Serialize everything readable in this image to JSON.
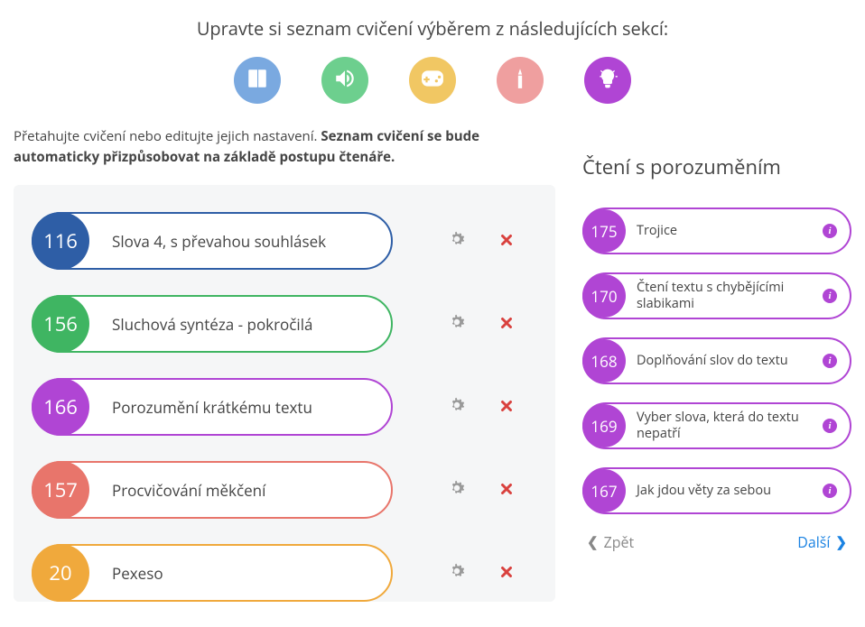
{
  "heading": "Upravte si seznam cvičení výběrem z následujících sekcí:",
  "instructions": {
    "pre": "Přetahujte cvičení nebo editujte jejich nastavení. ",
    "bold": "Seznam cvičení se bude automaticky přizpůsobovat na základě postupu čtenáře."
  },
  "categories": [
    {
      "name": "reading",
      "color": "#7aa9e0"
    },
    {
      "name": "listening",
      "color": "#6dcf8e"
    },
    {
      "name": "games",
      "color": "#f1c763"
    },
    {
      "name": "writing",
      "color": "#ef9f9f"
    },
    {
      "name": "comprehension",
      "color": "#b045d4"
    }
  ],
  "left_exercises": [
    {
      "num": "116",
      "label": "Slova 4, s převahou souhlásek",
      "color": "#2e5ea6"
    },
    {
      "num": "156",
      "label": "Sluchová syntéza - pokročilá",
      "color": "#3fb562"
    },
    {
      "num": "166",
      "label": "Porozumění krátkému textu",
      "color": "#b045d4"
    },
    {
      "num": "157",
      "label": "Procvičování měkčení",
      "color": "#e8756b"
    },
    {
      "num": "20",
      "label": "Pexeso",
      "color": "#f0a93c"
    }
  ],
  "right_panel": {
    "title": "Čtení s porozuměním",
    "items": [
      {
        "num": "175",
        "label": "Trojice"
      },
      {
        "num": "170",
        "label": "Čtení textu s chybějícími slabikami"
      },
      {
        "num": "168",
        "label": "Doplňování slov do textu"
      },
      {
        "num": "169",
        "label": "Vyber slova, která do textu nepatří"
      },
      {
        "num": "167",
        "label": "Jak jdou věty za sebou"
      }
    ],
    "back": "Zpět",
    "next": "Další"
  },
  "icons": {
    "gear": "gear",
    "remove": "remove",
    "info": "i"
  }
}
